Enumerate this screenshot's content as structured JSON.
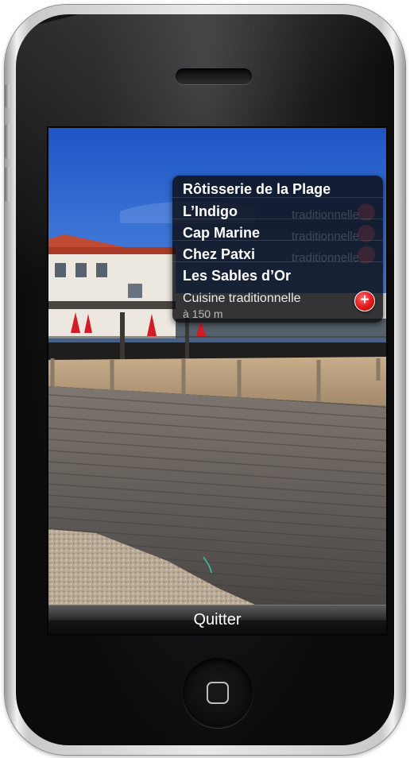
{
  "ar_overlay": {
    "pois": [
      {
        "name": "Rôtisserie de la Plage",
        "ghost": ""
      },
      {
        "name": "L’Indigo",
        "ghost": "traditionnelle"
      },
      {
        "name": "Cap Marine",
        "ghost": "traditionnelle"
      },
      {
        "name": "Chez Patxi",
        "ghost": "traditionnelle"
      },
      {
        "name": "Les Sables d’Or",
        "ghost": ""
      }
    ],
    "selected": {
      "description": "Cuisine traditionnelle",
      "distance": "à 150 m",
      "add_icon": "plus-icon",
      "add_symbol": "+"
    }
  },
  "toolbar": {
    "quit_label": "Quitter"
  },
  "colors": {
    "accent_red": "#e01818",
    "panel_bg": "#0c0c10"
  }
}
